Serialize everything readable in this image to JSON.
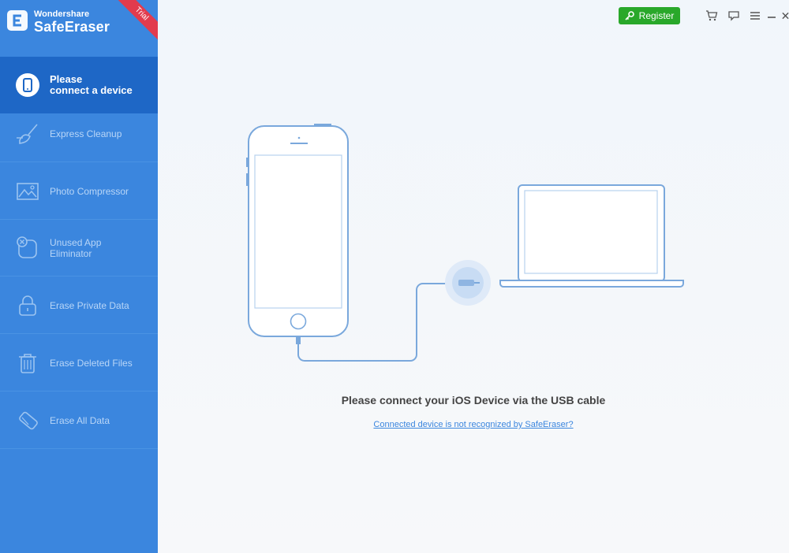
{
  "brand": {
    "vendor": "Wondershare",
    "product": "SafeEraser",
    "badge": "Trial"
  },
  "titlebar": {
    "register_label": "Register"
  },
  "sidebar": {
    "items": [
      {
        "label_line1": "Please",
        "label_line2": "connect a device",
        "icon": "phone-icon",
        "active": true
      },
      {
        "label_line1": "Express Cleanup",
        "label_line2": "",
        "icon": "broom-icon"
      },
      {
        "label_line1": "Photo Compressor",
        "label_line2": "",
        "icon": "photo-icon"
      },
      {
        "label_line1": "Unused App",
        "label_line2": "Eliminator",
        "icon": "app-remove-icon"
      },
      {
        "label_line1": "Erase Private Data",
        "label_line2": "",
        "icon": "lock-icon"
      },
      {
        "label_line1": "Erase Deleted Files",
        "label_line2": "",
        "icon": "trash-icon"
      },
      {
        "label_line1": "Erase All Data",
        "label_line2": "",
        "icon": "eraser-icon"
      }
    ]
  },
  "main": {
    "message": "Please connect your iOS Device via the USB cable",
    "help_link": "Connected device is not recognized by SafeEraser?"
  },
  "colors": {
    "sidebar": "#3b86de",
    "active": "#1e67c6",
    "register": "#29a82a",
    "trial": "#e23b4d"
  }
}
